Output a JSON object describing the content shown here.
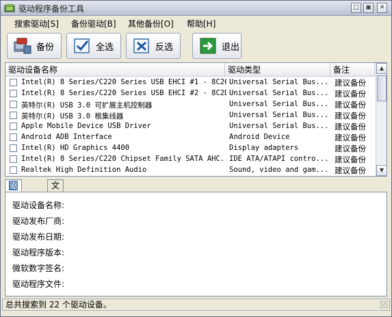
{
  "window": {
    "title": "驱动程序备份工具"
  },
  "title_buttons": {
    "minimize": "□",
    "restore": "▣",
    "close": "✕"
  },
  "menu": [
    "搜索驱动[S]",
    "备份驱动[B]",
    "其他备份[O]",
    "帮助[H]"
  ],
  "toolbar": {
    "backup_label": "备份",
    "select_all_label": "全选",
    "invert_label": "反选",
    "exit_label": "退出"
  },
  "list": {
    "headers": [
      "驱动设备名称",
      "驱动类型",
      "备注"
    ],
    "rows": [
      [
        "Intel(R) 8 Series/C220 Series USB EHCI #1 - 8C26",
        "Universal Serial Bus...",
        "建议备份"
      ],
      [
        "Intel(R) 8 Series/C220 Series USB EHCI #2 - 8C2D",
        "Universal Serial Bus...",
        "建议备份"
      ],
      [
        "英特尔(R) USB 3.0 可扩展主机控制器",
        "Universal Serial Bus...",
        "建议备份"
      ],
      [
        "英特尔(R) USB 3.0 根集线器",
        "Universal Serial Bus...",
        "建议备份"
      ],
      [
        "Apple Mobile Device USB Driver",
        "Universal Serial Bus...",
        "建议备份"
      ],
      [
        "Android ADB Interface",
        "Android Device",
        "建议备份"
      ],
      [
        "Intel(R) HD Graphics 4400",
        "Display adapters",
        "建议备份"
      ],
      [
        "Intel(R) 8 Series/C220 Chipset Family SATA AHC...",
        "IDE ATA/ATAPI contro...",
        "建议备份"
      ],
      [
        "Realtek High Definition Audio",
        "Sound, video and gam...",
        "建议备份"
      ]
    ]
  },
  "tabs": [
    "驱动摘要",
    "文件列表"
  ],
  "details": {
    "device_name_label": "驱动设备名称:",
    "vendor_label": "驱动发布厂商:",
    "date_label": "驱动发布日期:",
    "version_label": "驱动程序版本:",
    "signer_label": "微软数字签名:",
    "file_label": "驱动程序文件:"
  },
  "status": {
    "text": "总共搜索到 22 个驱动设备。"
  }
}
